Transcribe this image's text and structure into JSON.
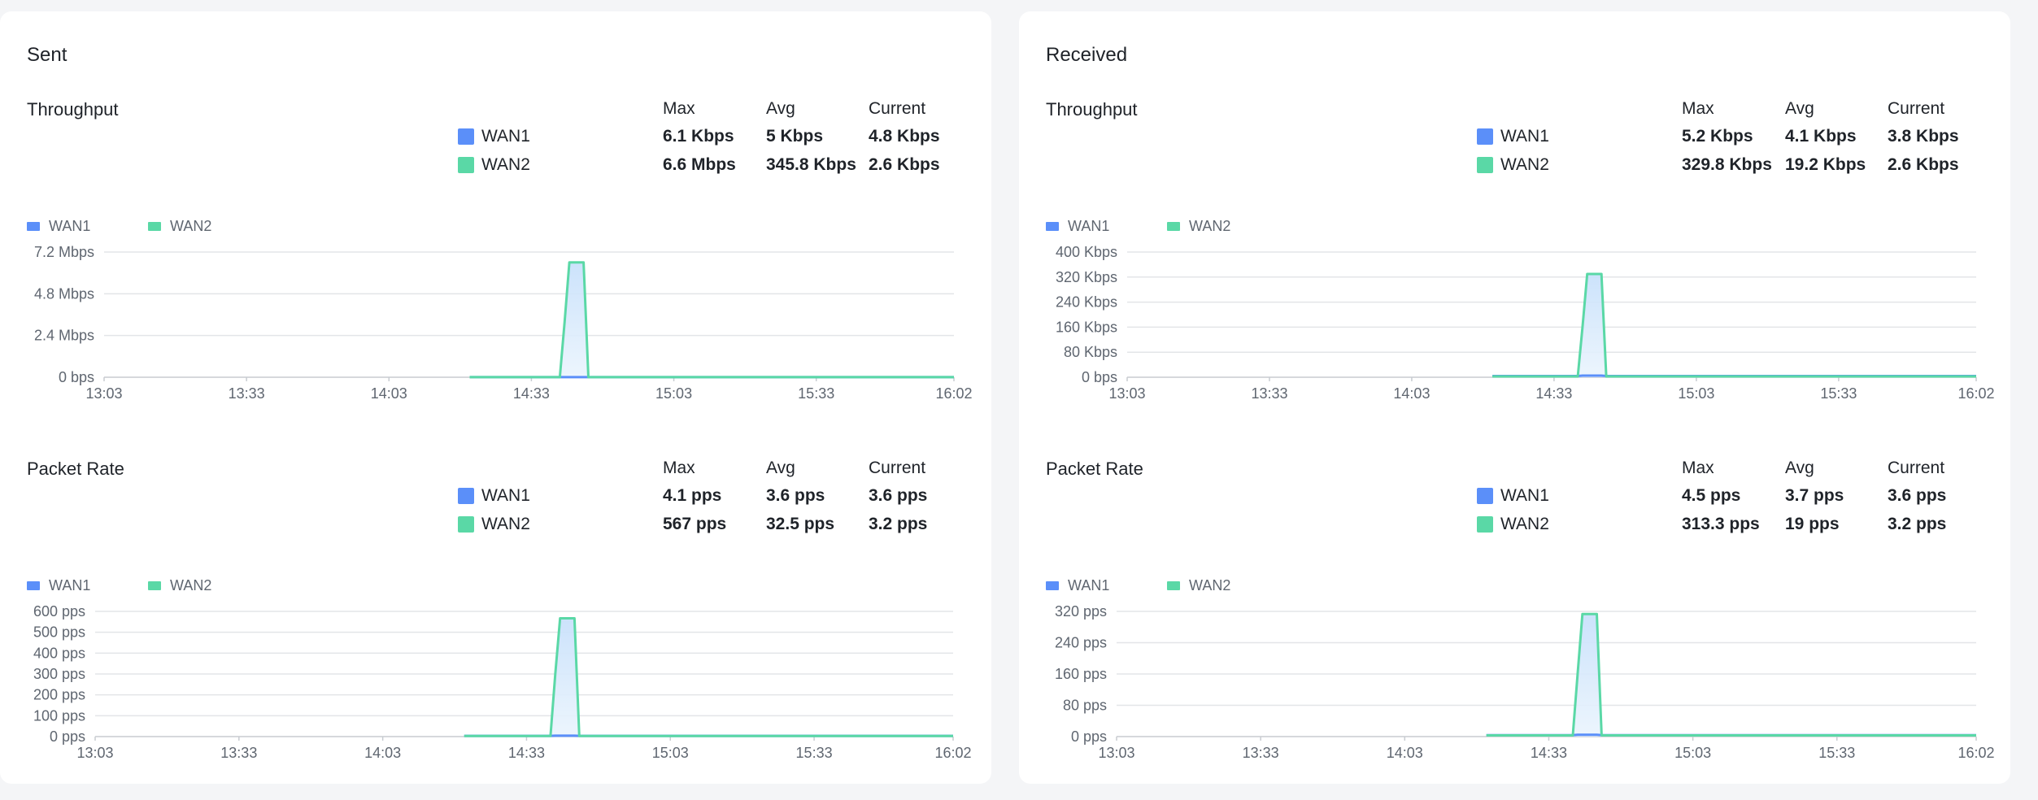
{
  "colors": {
    "wan1": "#5b8ff9",
    "wan2": "#5ad8a6",
    "grid": "#e3e5e8",
    "axis": "#c8ccd1",
    "tick": "#5f6670",
    "fill": "#d8e8fa"
  },
  "stats_headers": {
    "max": "Max",
    "avg": "Avg",
    "current": "Current"
  },
  "panels": [
    {
      "title": "Sent",
      "sections": [
        {
          "title": "Throughput",
          "stats": [
            {
              "name": "WAN1",
              "max": "6.1 Kbps",
              "avg": "5 Kbps",
              "current": "4.8 Kbps"
            },
            {
              "name": "WAN2",
              "max": "6.6 Mbps",
              "avg": "345.8 Kbps",
              "current": "2.6 Kbps"
            }
          ]
        },
        {
          "title": "Packet Rate",
          "stats": [
            {
              "name": "WAN1",
              "max": "4.1 pps",
              "avg": "3.6 pps",
              "current": "3.6 pps"
            },
            {
              "name": "WAN2",
              "max": "567 pps",
              "avg": "32.5 pps",
              "current": "3.2 pps"
            }
          ]
        }
      ]
    },
    {
      "title": "Received",
      "sections": [
        {
          "title": "Throughput",
          "stats": [
            {
              "name": "WAN1",
              "max": "5.2 Kbps",
              "avg": "4.1 Kbps",
              "current": "3.8 Kbps"
            },
            {
              "name": "WAN2",
              "max": "329.8 Kbps",
              "avg": "19.2 Kbps",
              "current": "2.6 Kbps"
            }
          ]
        },
        {
          "title": "Packet Rate",
          "stats": [
            {
              "name": "WAN1",
              "max": "4.5 pps",
              "avg": "3.7 pps",
              "current": "3.6 pps"
            },
            {
              "name": "WAN2",
              "max": "313.3 pps",
              "avg": "19 pps",
              "current": "3.2 pps"
            }
          ]
        }
      ]
    }
  ],
  "chart_data": [
    {
      "type": "area",
      "legend": [
        "WAN1",
        "WAN2"
      ],
      "ylim": [
        0,
        7.2
      ],
      "y_ticks": [
        0,
        2.4,
        4.8,
        7.2
      ],
      "y_tick_labels": [
        "0 bps",
        "2.4 Mbps",
        "4.8 Mbps",
        "7.2 Mbps"
      ],
      "x_ticks": [
        "13:03",
        "13:33",
        "14:03",
        "14:33",
        "15:03",
        "15:33",
        "16:02"
      ],
      "x_range": [
        "13:03",
        "16:02"
      ],
      "series": [
        {
          "name": "WAN1",
          "points": [
            [
              "14:20",
              0.0053
            ],
            [
              "14:39",
              0.0053
            ],
            [
              "14:40",
              0.0061
            ],
            [
              "14:43",
              0.0061
            ],
            [
              "14:44",
              0.005
            ],
            [
              "16:02",
              0.0048
            ]
          ]
        },
        {
          "name": "WAN2",
          "points": [
            [
              "14:20",
              0.003
            ],
            [
              "14:39",
              0.003
            ],
            [
              "14:40",
              3.2
            ],
            [
              "14:41",
              6.6
            ],
            [
              "14:44",
              6.6
            ],
            [
              "14:45",
              0.003
            ],
            [
              "16:02",
              0.0026
            ]
          ]
        }
      ]
    },
    {
      "type": "area",
      "legend": [
        "WAN1",
        "WAN2"
      ],
      "ylim": [
        0,
        600
      ],
      "y_ticks": [
        0,
        100,
        200,
        300,
        400,
        500,
        600
      ],
      "y_tick_labels": [
        "0 pps",
        "100 pps",
        "200 pps",
        "300 pps",
        "400 pps",
        "500 pps",
        "600 pps"
      ],
      "x_ticks": [
        "13:03",
        "13:33",
        "14:03",
        "14:33",
        "15:03",
        "15:33",
        "16:02"
      ],
      "x_range": [
        "13:03",
        "16:02"
      ],
      "series": [
        {
          "name": "WAN1",
          "points": [
            [
              "14:20",
              3.6
            ],
            [
              "14:38",
              3.6
            ],
            [
              "14:39",
              4.1
            ],
            [
              "14:43",
              4.1
            ],
            [
              "14:44",
              3.6
            ],
            [
              "16:02",
              3.6
            ]
          ]
        },
        {
          "name": "WAN2",
          "points": [
            [
              "14:20",
              3.2
            ],
            [
              "14:38",
              3.2
            ],
            [
              "14:39",
              300
            ],
            [
              "14:40",
              567
            ],
            [
              "14:43",
              567
            ],
            [
              "14:44",
              3.2
            ],
            [
              "16:02",
              3.2
            ]
          ]
        }
      ]
    },
    {
      "type": "area",
      "legend": [
        "WAN1",
        "WAN2"
      ],
      "ylim": [
        0,
        400
      ],
      "y_ticks": [
        0,
        80,
        160,
        240,
        320,
        400
      ],
      "y_tick_labels": [
        "0 bps",
        "80 Kbps",
        "160 Kbps",
        "240 Kbps",
        "320 Kbps",
        "400 Kbps"
      ],
      "x_ticks": [
        "13:03",
        "13:33",
        "14:03",
        "14:33",
        "15:03",
        "15:33",
        "16:02"
      ],
      "x_range": [
        "13:03",
        "16:02"
      ],
      "series": [
        {
          "name": "WAN1",
          "points": [
            [
              "14:20",
              3.8
            ],
            [
              "14:38",
              3.8
            ],
            [
              "14:39",
              5.2
            ],
            [
              "14:43",
              5.2
            ],
            [
              "14:44",
              4.0
            ],
            [
              "16:02",
              3.8
            ]
          ]
        },
        {
          "name": "WAN2",
          "points": [
            [
              "14:20",
              2.6
            ],
            [
              "14:38",
              2.6
            ],
            [
              "14:39",
              160
            ],
            [
              "14:40",
              329.8
            ],
            [
              "14:43",
              329.8
            ],
            [
              "14:44",
              2.6
            ],
            [
              "16:02",
              2.6
            ]
          ]
        }
      ]
    },
    {
      "type": "area",
      "legend": [
        "WAN1",
        "WAN2"
      ],
      "ylim": [
        0,
        320
      ],
      "y_ticks": [
        0,
        80,
        160,
        240,
        320
      ],
      "y_tick_labels": [
        "0 pps",
        "80 pps",
        "160 pps",
        "240 pps",
        "320 pps"
      ],
      "x_ticks": [
        "13:03",
        "13:33",
        "14:03",
        "14:33",
        "15:03",
        "15:33",
        "16:02"
      ],
      "x_range": [
        "13:03",
        "16:02"
      ],
      "series": [
        {
          "name": "WAN1",
          "points": [
            [
              "14:20",
              3.6
            ],
            [
              "14:38",
              3.6
            ],
            [
              "14:39",
              4.5
            ],
            [
              "14:43",
              4.5
            ],
            [
              "14:44",
              3.6
            ],
            [
              "16:02",
              3.6
            ]
          ]
        },
        {
          "name": "WAN2",
          "points": [
            [
              "14:20",
              3.2
            ],
            [
              "14:38",
              3.2
            ],
            [
              "14:39",
              160
            ],
            [
              "14:40",
              313.3
            ],
            [
              "14:43",
              313.3
            ],
            [
              "14:44",
              3.2
            ],
            [
              "16:02",
              3.2
            ]
          ]
        }
      ]
    }
  ]
}
